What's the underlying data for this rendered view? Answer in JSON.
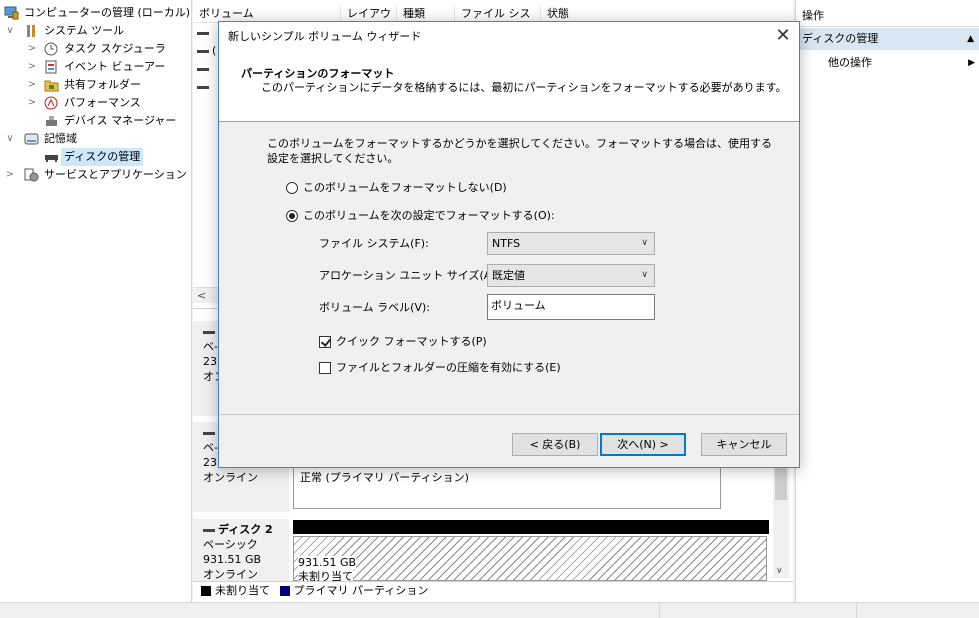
{
  "tree": {
    "items": [
      {
        "label": "コンピューターの管理 (ローカル)"
      },
      {
        "label": "システム ツール"
      },
      {
        "label": "タスク スケジューラ"
      },
      {
        "label": "イベント ビューアー"
      },
      {
        "label": "共有フォルダー"
      },
      {
        "label": "パフォーマンス"
      },
      {
        "label": "デバイス マネージャー"
      },
      {
        "label": "記憶域"
      },
      {
        "label": "ディスクの管理"
      },
      {
        "label": "サービスとアプリケーション"
      }
    ]
  },
  "volumes": {
    "columns": [
      "ボリューム",
      "レイアウト",
      "種類",
      "ファイル システム",
      "状態"
    ],
    "rows": [
      "(",
      "",
      ""
    ]
  },
  "disks": [
    {
      "line1": "ベ-",
      "line2": "23:",
      "line3": "オン"
    },
    {
      "line1": "ベ-",
      "line2": "23:",
      "line3": "オンライン",
      "partition_status": "正常 (プライマリ パーティション)"
    },
    {
      "name": "ディスク 2",
      "type": "ベーシック",
      "size": "931.51 GB",
      "state": "オンライン",
      "partition_size": "931.51 GB",
      "partition_status": "未割り当て"
    }
  ],
  "legend": {
    "unallocated": "未割り当て",
    "primary": "プライマリ パーティション"
  },
  "actions": {
    "header": "操作",
    "selected": "ディスクの管理",
    "more": "他の操作"
  },
  "dialog": {
    "title": "新しいシンプル ボリューム ウィザード",
    "header_title": "パーティションのフォーマット",
    "header_subtitle": "このパーティションにデータを格納するには、最初にパーティションをフォーマットする必要があります。",
    "description": "このボリュームをフォーマットするかどうかを選択してください。フォーマットする場合は、使用する設定を選択してください。",
    "option_no_format": "このボリュームをフォーマットしない(D)",
    "option_format": "このボリュームを次の設定でフォーマットする(O):",
    "fs_label": "ファイル システム(F):",
    "fs_value": "NTFS",
    "alloc_label": "アロケーション ユニット サイズ(A):",
    "alloc_value": "既定値",
    "vol_label": "ボリューム ラベル(V):",
    "vol_value": "ボリューム",
    "quick_format": "クイック フォーマットする(P)",
    "compression": "ファイルとフォルダーの圧縮を有効にする(E)",
    "back_button": "< 戻る(B)",
    "next_button": "次へ(N) >",
    "cancel_button": "キャンセル",
    "format_selected": true,
    "quick_format_checked": true,
    "compression_checked": false
  },
  "colors": {
    "selection": "#cce8ff",
    "action_selected": "#d8e6f2",
    "primary_partition": "#000080",
    "unallocated": "#000000",
    "default_button_border": "#0078d7"
  }
}
